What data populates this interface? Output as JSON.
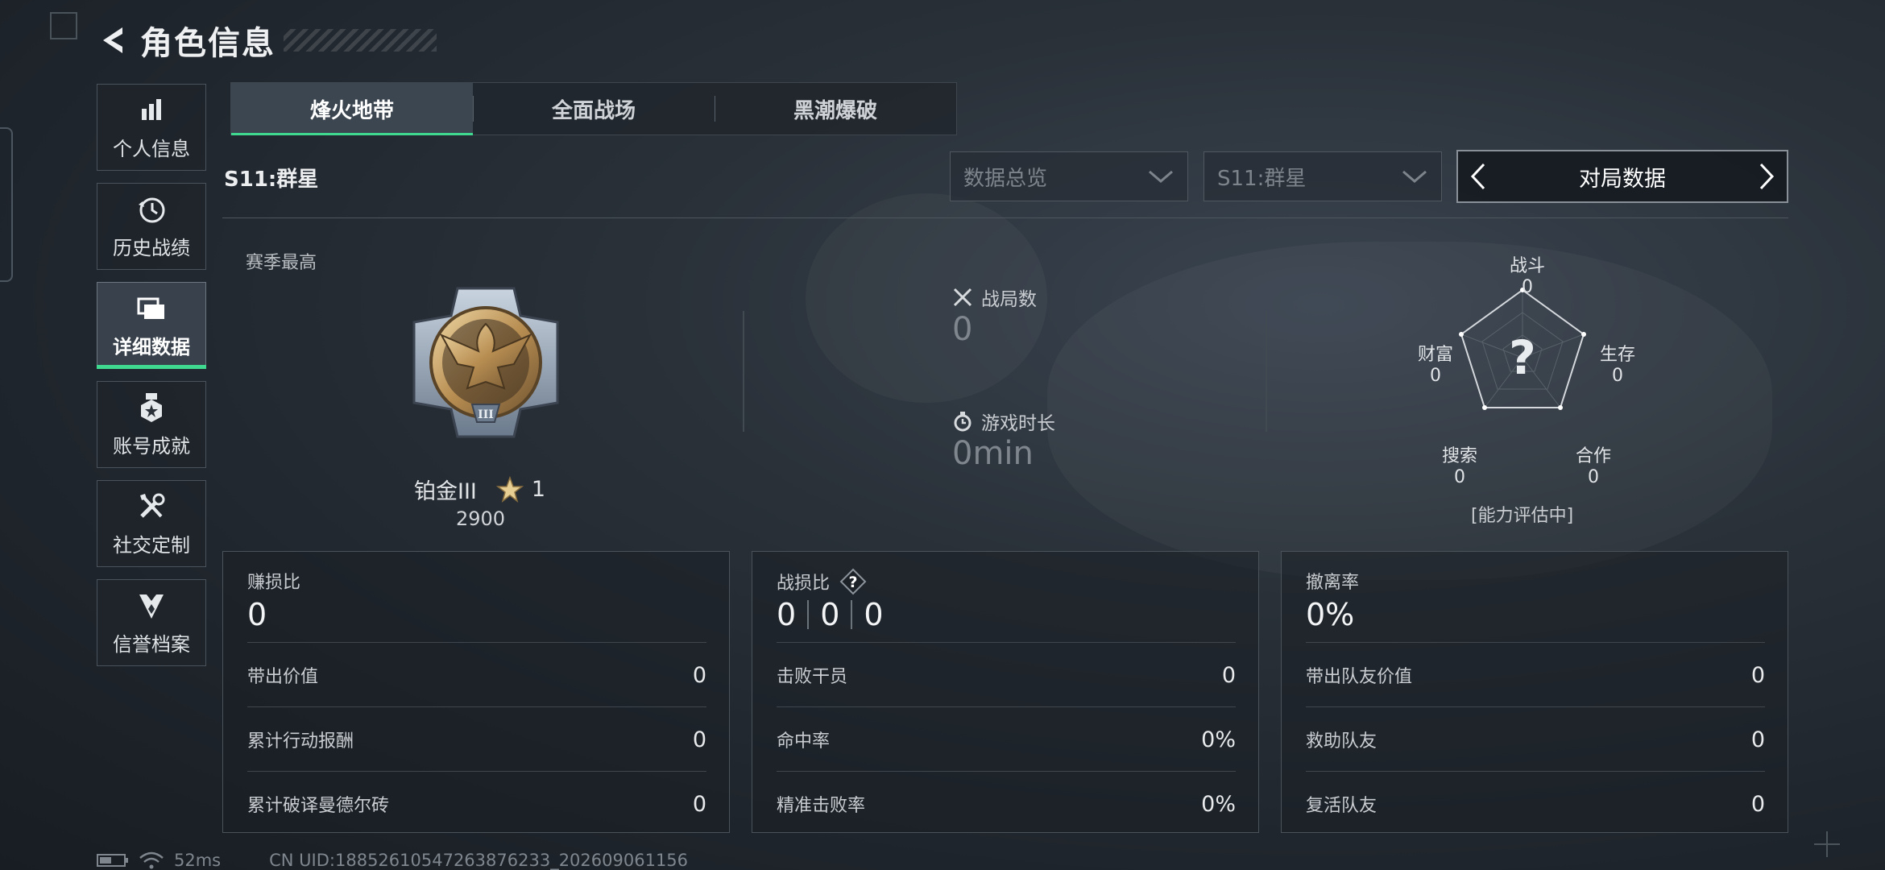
{
  "header": {
    "title": "角色信息"
  },
  "sidebar": {
    "items": [
      {
        "label": "个人信息",
        "icon": "bar-chart-icon"
      },
      {
        "label": "历史战绩",
        "icon": "history-clock-icon"
      },
      {
        "label": "详细数据",
        "icon": "cards-icon",
        "active": true
      },
      {
        "label": "账号成就",
        "icon": "medal-icon"
      },
      {
        "label": "社交定制",
        "icon": "tools-icon"
      },
      {
        "label": "信誉档案",
        "icon": "shield-emblem-icon"
      }
    ]
  },
  "tabs": [
    {
      "label": "烽火地带",
      "active": true
    },
    {
      "label": "全面战场"
    },
    {
      "label": "黑潮爆破"
    }
  ],
  "filters": {
    "season_label": "S11:群星",
    "overview_dropdown": "数据总览",
    "season_dropdown": "S11:群星",
    "mode_switch": "对局数据"
  },
  "best": {
    "label": "赛季最高",
    "rank_name": "铂金III",
    "stars": "1",
    "score": "2900",
    "badge_numeral": "III"
  },
  "stats": {
    "matches_label": "战局数",
    "matches_value": "0",
    "playtime_label": "游戏时长",
    "playtime_value": "0min"
  },
  "radar": {
    "center_mark": "?",
    "combat_label": "战斗",
    "combat_value": "0",
    "survival_label": "生存",
    "survival_value": "0",
    "teamwork_label": "合作",
    "teamwork_value": "0",
    "search_label": "搜索",
    "search_value": "0",
    "wealth_label": "财富",
    "wealth_value": "0",
    "status": "[能力评估中]"
  },
  "cards": {
    "profit": {
      "title": "赚损比",
      "value": "0",
      "rows": [
        {
          "label": "带出价值",
          "value": "0"
        },
        {
          "label": "累计行动报酬",
          "value": "0"
        },
        {
          "label": "累计破译曼德尔砖",
          "value": "0"
        }
      ]
    },
    "combat": {
      "title": "战损比",
      "help": "?",
      "values": [
        "0",
        "0",
        "0"
      ],
      "rows": [
        {
          "label": "击败干员",
          "value": "0"
        },
        {
          "label": "命中率",
          "value": "0%"
        },
        {
          "label": "精准击败率",
          "value": "0%"
        }
      ]
    },
    "extract": {
      "title": "撤离率",
      "value": "0%",
      "rows": [
        {
          "label": "带出队友价值",
          "value": "0"
        },
        {
          "label": "救助队友",
          "value": "0"
        },
        {
          "label": "复活队友",
          "value": "0"
        }
      ]
    }
  },
  "status_bar": {
    "ping": "52ms",
    "uid": "CN UID:18852610547263876233_202609061156"
  },
  "colors": {
    "accent": "#3fd98f",
    "background": "#232a31"
  }
}
